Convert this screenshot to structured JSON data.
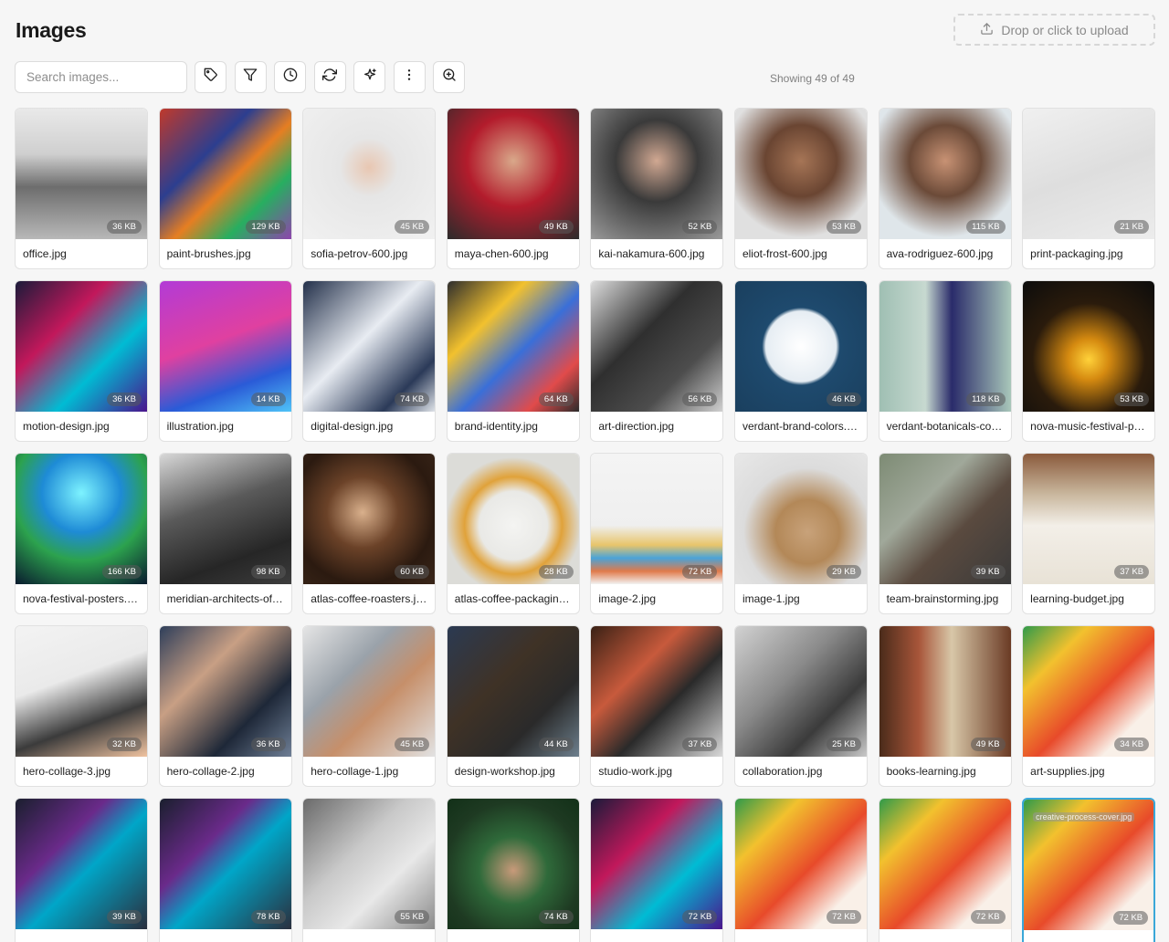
{
  "header": {
    "title": "Images",
    "upload_label": "Drop or click to upload"
  },
  "toolbar": {
    "search_placeholder": "Search images...",
    "buttons": [
      {
        "name": "tag-filter-button",
        "icon": "tag-icon"
      },
      {
        "name": "filter-button",
        "icon": "filter-icon"
      },
      {
        "name": "recent-button",
        "icon": "clock-icon"
      },
      {
        "name": "refresh-button",
        "icon": "refresh-icon"
      },
      {
        "name": "ai-sparkle-button",
        "icon": "sparkle-icon"
      },
      {
        "name": "more-options-button",
        "icon": "more-vertical-icon"
      },
      {
        "name": "zoom-button",
        "icon": "zoom-in-icon"
      }
    ],
    "count_text": "Showing 49 of 49"
  },
  "images": [
    {
      "name": "office.jpg",
      "size": "36 KB",
      "bg": "linear-gradient(180deg,#e9e9e9 0%,#cfcfcf 35%,#6d6d6d 60%,#b8b8b8 100%)"
    },
    {
      "name": "paint-brushes.jpg",
      "size": "129 KB",
      "bg": "linear-gradient(135deg,#c0392b 0%,#2c3e8f 35%,#e67e22 55%,#27ae60 75%,#8e44ad 100%)"
    },
    {
      "name": "sofia-petrov-600.jpg",
      "size": "45 KB",
      "bg": "radial-gradient(circle at 50% 45%,#e8c7b2 0%,#e6e6e6 30%,#f1f1f1 100%)"
    },
    {
      "name": "maya-chen-600.jpg",
      "size": "49 KB",
      "bg": "radial-gradient(circle at 50% 40%,#d9a88a 0%,#b31c2c 45%,#2b2b2b 100%)"
    },
    {
      "name": "kai-nakamura-600.jpg",
      "size": "52 KB",
      "bg": "radial-gradient(circle at 50% 40%,#d1a892 0%,#3a3a3a 40%,#9a9a9a 100%)"
    },
    {
      "name": "eliot-frost-600.jpg",
      "size": "53 KB",
      "bg": "radial-gradient(circle at 50% 40%,#a67556 0%,#6a4532 35%,#e0e0e0 75%)"
    },
    {
      "name": "ava-rodriguez-600.jpg",
      "size": "115 KB",
      "bg": "radial-gradient(circle at 50% 40%,#c89274 0%,#6b4a38 35%,#dfe6ea 75%)"
    },
    {
      "name": "print-packaging.jpg",
      "size": "21 KB",
      "bg": "linear-gradient(160deg,#f0f0f0 0%,#dedede 50%,#ececec 100%)"
    },
    {
      "name": "motion-design.jpg",
      "size": "36 KB",
      "bg": "linear-gradient(135deg,#1b1b3a 0%,#c2185b 35%,#00bcd4 65%,#4a148c 100%)"
    },
    {
      "name": "illustration.jpg",
      "size": "14 KB",
      "bg": "linear-gradient(160deg,#b23bd6 0%,#e040a0 45%,#2a5bd7 75%,#4fc3f7 100%)"
    },
    {
      "name": "digital-design.jpg",
      "size": "74 KB",
      "bg": "linear-gradient(135deg,#23304a 0%,#e8ecf2 45%,#2b3a58 80%,#dfe3e8 100%)"
    },
    {
      "name": "brand-identity.jpg",
      "size": "64 KB",
      "bg": "linear-gradient(135deg,#2d2d2d 0%,#f2c12e 30%,#3a6fd8 55%,#e14b4b 80%,#2b2b2b 100%)"
    },
    {
      "name": "art-direction.jpg",
      "size": "56 KB",
      "bg": "linear-gradient(135deg,#dcdcdc 0%,#2f2f2f 40%,#4d4d4d 70%,#d0d0d0 100%)"
    },
    {
      "name": "verdant-brand-colors.jpg",
      "size": "46 KB",
      "bg": "radial-gradient(circle at 50% 50%,#ffffff 0%,#e6edf3 38%,#1e4a6e 42%,#1a3f5e 100%)"
    },
    {
      "name": "verdant-botanicals-collection.jpg",
      "size": "118 KB",
      "bg": "linear-gradient(90deg,#9fbfb3 0%,#c7d9d0 35%,#2a2b6a 55%,#a9c7ba 100%)"
    },
    {
      "name": "nova-music-festival-poster.jpg",
      "size": "53 KB",
      "bg": "radial-gradient(circle at 50% 60%,#ffd23a 0%,#d58a10 20%,#2a1b0c 55%,#0c0c0c 100%)"
    },
    {
      "name": "nova-festival-posters.jpg",
      "size": "166 KB",
      "bg": "radial-gradient(circle at 50% 30%,#7df3ff 0%,#1e8bd6 35%,#2ca24e 60%,#091a2e 100%)"
    },
    {
      "name": "meridian-architects-office.jpg",
      "size": "98 KB",
      "bg": "linear-gradient(160deg,#d8d8d8 0%,#5a5a5a 40%,#262626 75%,#3d3d3d 100%)"
    },
    {
      "name": "atlas-coffee-roasters.jpg",
      "size": "60 KB",
      "bg": "radial-gradient(circle at 45% 45%,#d9b08c 0%,#6b4228 35%,#2b1a10 70%,#3a2619 100%)"
    },
    {
      "name": "atlas-coffee-packaging.jpg",
      "size": "28 KB",
      "bg": "radial-gradient(circle at 50% 55%,#f4f4f2 0%,#e9e9e6 35%,#e0a23a 50%,#dcdcd8 70%)"
    },
    {
      "name": "image-2.jpg",
      "size": "72 KB",
      "bg": "linear-gradient(180deg,#f4f4f4 0%,#efefef 55%,#e8c56b 70%,#4aa3d8 80%,#e07a4a 90%,#f2f2f2 100%)"
    },
    {
      "name": "image-1.jpg",
      "size": "29 KB",
      "bg": "radial-gradient(circle at 55% 60%,#c8a27a 0%,#b38858 30%,#dcdcdc 60%,#e8e8e8 100%)"
    },
    {
      "name": "team-brainstorming.jpg",
      "size": "39 KB",
      "bg": "linear-gradient(135deg,#7d8b74 0%,#a0a89a 35%,#5a4a3f 60%,#3a3a3a 100%)"
    },
    {
      "name": "learning-budget.jpg",
      "size": "37 KB",
      "bg": "linear-gradient(180deg,#8a5a3c 0%,#c7b49a 30%,#f3efe8 55%,#e8e2d6 100%)"
    },
    {
      "name": "hero-collage-3.jpg",
      "size": "32 KB",
      "bg": "linear-gradient(160deg,#f3f3f3 0%,#eaeaea 40%,#3b3b3b 70%,#f0c3a0 100%)"
    },
    {
      "name": "hero-collage-2.jpg",
      "size": "36 KB",
      "bg": "linear-gradient(135deg,#2e3e5a 0%,#c89f84 35%,#1e2838 70%,#6f7f96 100%)"
    },
    {
      "name": "hero-collage-1.jpg",
      "size": "45 KB",
      "bg": "linear-gradient(135deg,#e5e5e5 0%,#9aa2aa 35%,#c68f6a 60%,#e2e2e2 100%)"
    },
    {
      "name": "design-workshop.jpg",
      "size": "44 KB",
      "bg": "linear-gradient(135deg,#2b3a52 0%,#3f3226 40%,#2a2a2a 70%,#6d7f8d 100%)"
    },
    {
      "name": "studio-work.jpg",
      "size": "37 KB",
      "bg": "linear-gradient(135deg,#3a2115 0%,#c85a3c 35%,#2a2a2a 60%,#d9d9d9 100%)"
    },
    {
      "name": "collaboration.jpg",
      "size": "25 KB",
      "bg": "linear-gradient(135deg,#d2d2d2 0%,#8a8a8a 40%,#3b3b3b 70%,#c9c9c9 100%)"
    },
    {
      "name": "books-learning.jpg",
      "size": "49 KB",
      "bg": "linear-gradient(90deg,#4a2b1a 0%,#a8563a 30%,#d8c7a8 55%,#6a3a24 100%)"
    },
    {
      "name": "art-supplies.jpg",
      "size": "34 KB",
      "bg": "linear-gradient(135deg,#2f9a4a 0%,#f2c12e 25%,#e84a2a 55%,#f9f0e8 80%)"
    },
    {
      "name": "",
      "size": "39 KB",
      "bg": "linear-gradient(135deg,#1a1f2e 0%,#6a2a8a 35%,#00a6c8 55%,#2a2f3e 100%)"
    },
    {
      "name": "",
      "size": "78 KB",
      "bg": "linear-gradient(135deg,#1a1f2e 0%,#6a2a8a 35%,#00a6c8 55%,#2a2f3e 100%)"
    },
    {
      "name": "",
      "size": "55 KB",
      "bg": "linear-gradient(135deg,#6a6a6a 0%,#c9c9c9 40%,#e8e8e8 65%,#8a8a8a 100%)"
    },
    {
      "name": "",
      "size": "74 KB",
      "bg": "radial-gradient(circle at 50% 55%,#c89a7a 0%,#2f6a3a 35%,#1e3a22 70%,#123018 100%)"
    },
    {
      "name": "",
      "size": "72 KB",
      "bg": "linear-gradient(135deg,#1b1b3a 0%,#c2185b 35%,#00bcd4 65%,#4a148c 100%)"
    },
    {
      "name": "",
      "size": "72 KB",
      "bg": "linear-gradient(135deg,#2f9a4a 0%,#f2c12e 25%,#e84a2a 55%,#f9f0e8 80%)"
    },
    {
      "name": "",
      "size": "72 KB",
      "bg": "linear-gradient(135deg,#2f9a4a 0%,#f2c12e 25%,#e84a2a 55%,#f9f0e8 80%)"
    },
    {
      "name": "",
      "size": "72 KB",
      "bg": "linear-gradient(135deg,#2f9a4a 0%,#f2c12e 25%,#e84a2a 55%,#f9f0e8 80%)",
      "overlay": "creative-process-cover.jpg",
      "selected": true
    }
  ]
}
